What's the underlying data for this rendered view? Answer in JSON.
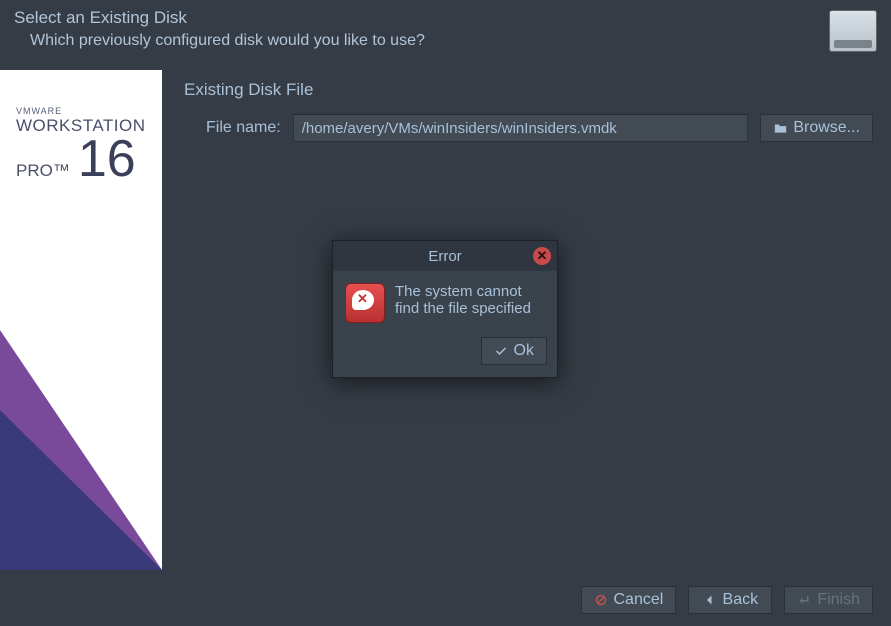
{
  "header": {
    "title": "Select an Existing Disk",
    "subtitle": "Which previously configured disk would you like to use?"
  },
  "sidebar": {
    "brand_small": "VMWARE",
    "brand_mid": "WORKSTATION",
    "brand_pro": "PRO™",
    "brand_version": "16"
  },
  "content": {
    "section_title": "Existing Disk File",
    "file_label": "File name:",
    "file_value": "/home/avery/VMs/winInsiders/winInsiders.vmdk",
    "browse_label": "Browse..."
  },
  "dialog": {
    "title": "Error",
    "message": "The system cannot find the file specified",
    "ok_label": "Ok"
  },
  "footer": {
    "cancel": "Cancel",
    "back": "Back",
    "finish": "Finish"
  },
  "icons": {
    "browse": "folder-icon",
    "cancel": "prohibit-icon",
    "back": "arrow-left-icon",
    "finish": "enter-icon",
    "ok": "check-icon",
    "close": "close-icon",
    "disk": "disk-icon",
    "error": "error-icon"
  }
}
